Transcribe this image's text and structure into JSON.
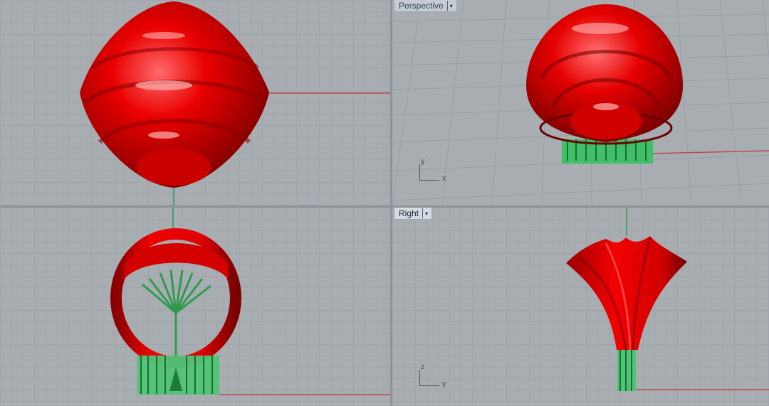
{
  "viewports": {
    "top": {
      "label": ""
    },
    "perspective": {
      "label": "Perspective",
      "menu_glyph": "▾",
      "axis_x": "x",
      "axis_y": "y"
    },
    "front": {
      "label": ""
    },
    "right": {
      "label": "Right",
      "menu_glyph": "▾",
      "axis_h": "y",
      "axis_v": "z"
    }
  },
  "colors": {
    "viewport_bg": "#a8adb2",
    "grid_minor": "#9aa0a6",
    "grid_major": "#8a9096",
    "model_red": "#e10000",
    "support_green": "#3fbf68",
    "axis_red": "#b84b4b",
    "axis_green": "#2f9a4d"
  }
}
